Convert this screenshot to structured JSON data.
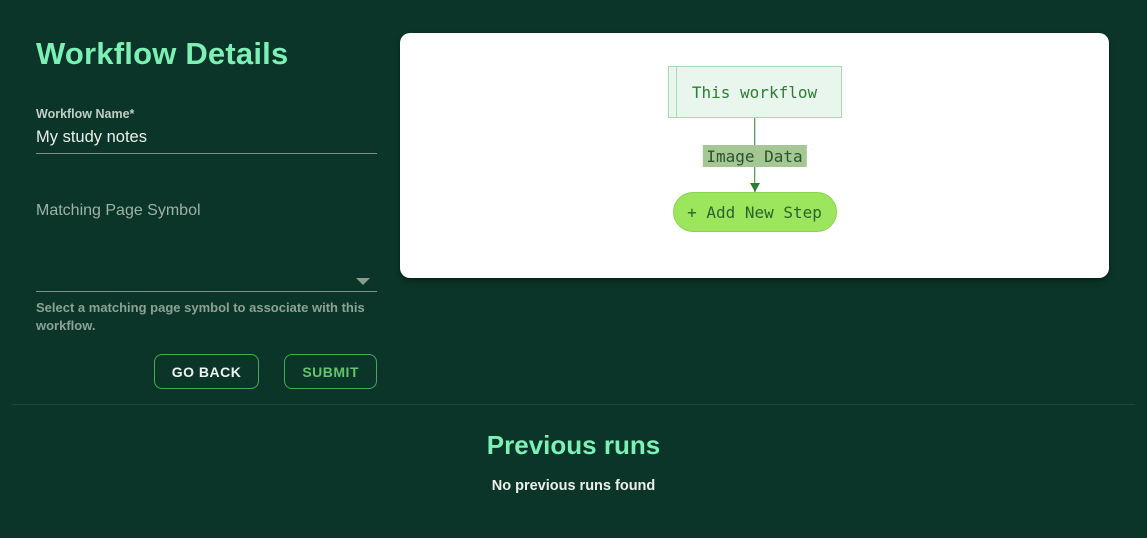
{
  "form": {
    "title": "Workflow Details",
    "name_field": {
      "label": "Workflow Name*",
      "value": "My study notes"
    },
    "symbol_field": {
      "label": "Matching Page Symbol",
      "selected_value": "",
      "helper": "Select a matching page symbol to associate with this workflow."
    },
    "buttons": {
      "go_back": "GO BACK",
      "submit": "SUBMIT"
    }
  },
  "diagram": {
    "node_label": "This workflow",
    "edge_label": "Image Data",
    "add_step_label": "+ Add New Step"
  },
  "previous_runs": {
    "title": "Previous runs",
    "empty_message": "No previous runs found"
  },
  "colors": {
    "background": "#0b3528",
    "accent_mint": "#7df0b6",
    "button_border_green": "#47a956",
    "submit_text_green": "#63c46d",
    "card_background": "#ffffff",
    "node_fill": "#e9f6ed",
    "node_border": "#a8dbb0",
    "node_text": "#2e7d36",
    "edge_stroke": "#2e7d32",
    "edge_label_background": "#a4c794",
    "add_step_fill": "#9ce65e",
    "add_step_border": "#88d44d",
    "add_step_text": "#2a632d"
  }
}
